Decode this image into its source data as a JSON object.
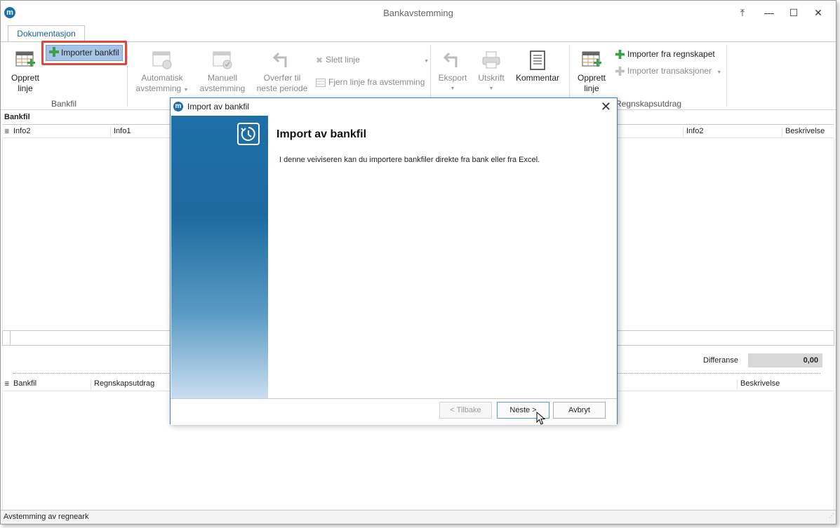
{
  "window": {
    "title": "Bankavstemming",
    "logo_letter": "m",
    "controls": {
      "restore_pin": "⤒",
      "minimize": "—",
      "maximize": "☐",
      "close": "✕"
    }
  },
  "ribbon": {
    "tab": "Dokumentasjon",
    "bankfil_group": {
      "label": "Bankfil",
      "opprett_linje_line1": "Opprett",
      "opprett_linje_line2": "linje",
      "importer_bankfil": "Importer bankfil"
    },
    "avstemming": {
      "automatisk_line1": "Automatisk",
      "automatisk_line2": "avstemming",
      "manuell_line1": "Manuell",
      "manuell_line2": "avstemming",
      "overfor_line1": "Overfør til",
      "overfor_line2": "neste periode",
      "slett_linje": "Slett linje",
      "fjern_linje": "Fjern linje fra avstemming"
    },
    "output": {
      "eksport": "Eksport",
      "utskrift": "Utskrift",
      "kommentar": "Kommentar"
    },
    "regnskapsutdrag_group": {
      "label": "Regnskapsutdrag",
      "opprett_linje_line1": "Opprett",
      "opprett_linje_line2": "linje",
      "importer_regnskapet": "Importer fra regnskapet",
      "importer_transaksjoner": "Importer transaksjoner"
    }
  },
  "bankfil_section": {
    "label": "Bankfil",
    "columns": [
      "Info2",
      "Info1",
      "Info2",
      "Beskrivelse"
    ]
  },
  "summary": {
    "differanse_label": "Differanse",
    "differanse_value": "0,00"
  },
  "matched_section": {
    "columns": [
      "Bankfil",
      "Regnskapsutdrag",
      "Beskrivelse"
    ]
  },
  "status_bar": {
    "text": "Avstemming av regneark"
  },
  "dialog": {
    "title": "Import av bankfil",
    "heading": "Import av bankfil",
    "description": "I denne veiviseren kan du importere bankfiler direkte fra bank eller fra Excel.",
    "buttons": {
      "back": "< Tilbake",
      "next": "Neste >",
      "cancel": "Avbryt"
    }
  },
  "colors": {
    "accent_blue": "#1b6fae",
    "highlight_red": "#e0463d",
    "selected_button": "#a6c4e6",
    "green_plus": "#3aa04a"
  }
}
